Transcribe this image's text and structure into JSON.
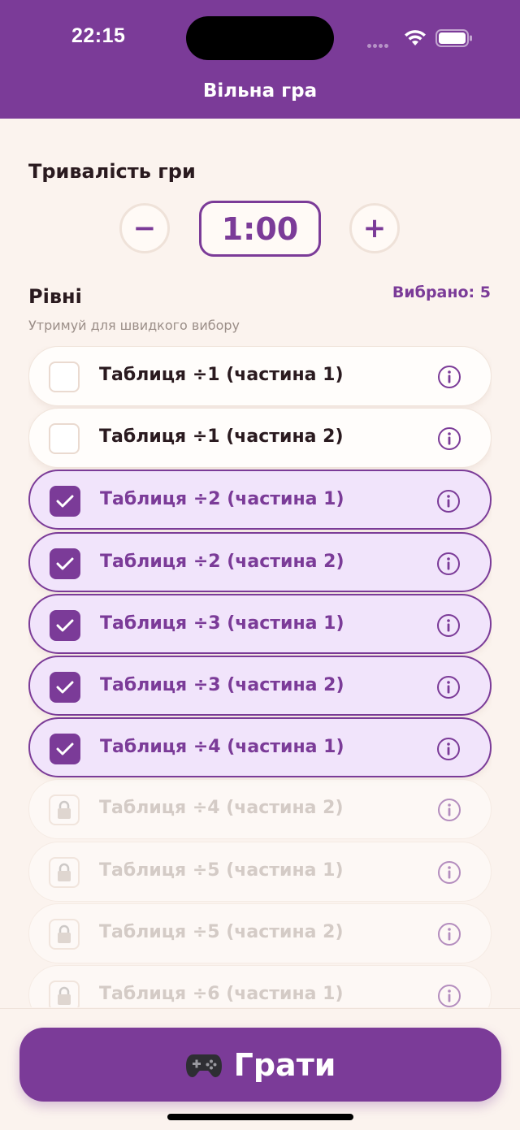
{
  "status_bar": {
    "time": "22:15"
  },
  "header": {
    "title": "Вільна гра"
  },
  "duration": {
    "title": "Тривалість гри",
    "value": "1:00",
    "minus_label": "−",
    "plus_label": "+"
  },
  "levels": {
    "title": "Рівні",
    "selected_label": "Вибрано: 5",
    "hint": "Утримуй для швидкого вибору",
    "items": [
      {
        "label": "Таблиця ÷1 (частина 1)",
        "state": "unchecked"
      },
      {
        "label": "Таблиця ÷1 (частина 2)",
        "state": "unchecked"
      },
      {
        "label": "Таблиця ÷2 (частина 1)",
        "state": "checked"
      },
      {
        "label": "Таблиця ÷2 (частина 2)",
        "state": "checked"
      },
      {
        "label": "Таблиця ÷3 (частина 1)",
        "state": "checked"
      },
      {
        "label": "Таблиця ÷3 (частина 2)",
        "state": "checked"
      },
      {
        "label": "Таблиця ÷4 (частина 1)",
        "state": "checked"
      },
      {
        "label": "Таблиця ÷4 (частина 2)",
        "state": "locked"
      },
      {
        "label": "Таблиця ÷5 (частина 1)",
        "state": "locked"
      },
      {
        "label": "Таблиця ÷5 (частина 2)",
        "state": "locked"
      },
      {
        "label": "Таблиця ÷6 (частина 1)",
        "state": "locked"
      }
    ]
  },
  "play": {
    "label": "Грати",
    "icon": "gamepad-icon"
  },
  "colors": {
    "accent": "#7b3b98",
    "background": "#fbf3ee",
    "checked_bg": "#f1e4fb"
  }
}
